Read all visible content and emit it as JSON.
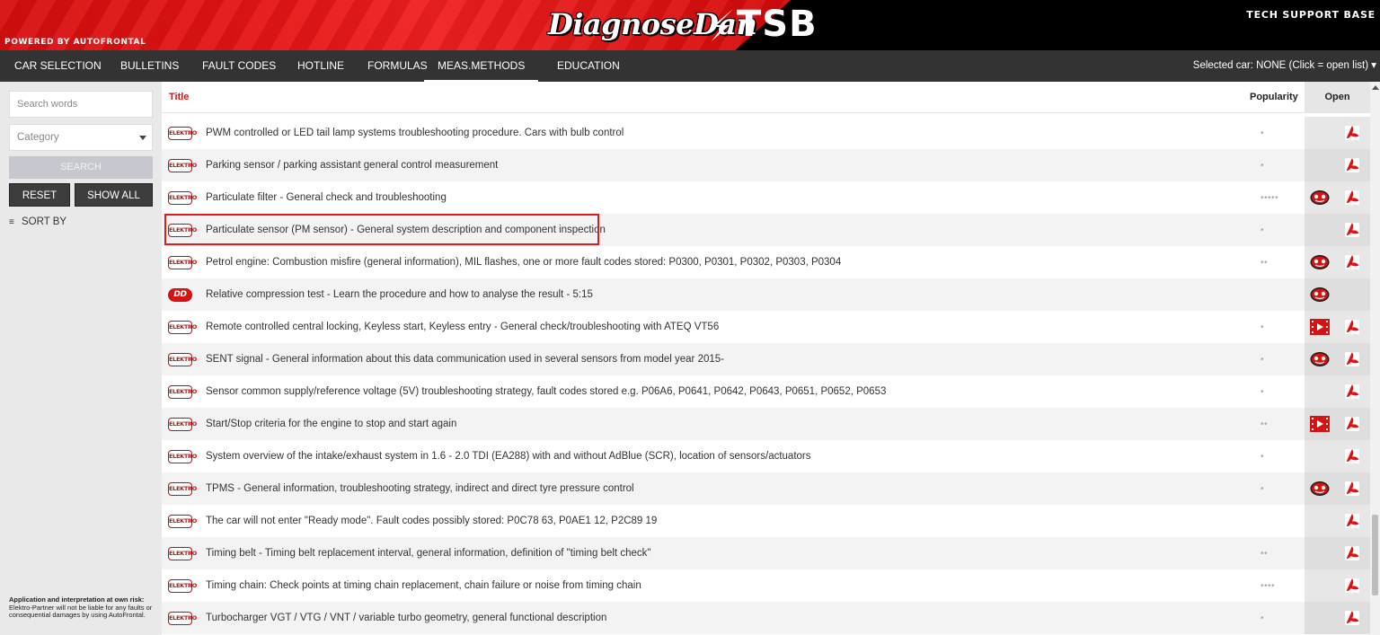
{
  "header": {
    "powered_by": "POWERED BY AUTOFRONTAL",
    "logo_script": "DiagnoseDan",
    "logo_tsb": "TSB",
    "caption": "TECH SUPPORT BASE"
  },
  "nav": {
    "items": [
      "CAR SELECTION",
      "BULLETINS",
      "FAULT CODES",
      "HOTLINE",
      "FORMULAS",
      "MEAS.METHODS",
      "EDUCATION"
    ],
    "active": "MEAS.METHODS",
    "selected_car": "Selected car: NONE (Click = open list) ▾"
  },
  "sidebar": {
    "search_placeholder": "Search words",
    "category_placeholder": "Category",
    "search_label": "SEARCH",
    "reset_label": "RESET",
    "show_all_label": "SHOW ALL",
    "sort_by_label": "SORT BY",
    "disclaimer_title": "Application and interpretation at own risk:",
    "disclaimer_body": "Elektro-Partner will not be liable for any faults or consequential damages by using AutoFrontal."
  },
  "table": {
    "col_title": "Title",
    "col_popularity": "Popularity",
    "col_open": "Open",
    "badge_elektro": "ELEKTRO",
    "badge_dd": "DD",
    "rows": [
      {
        "title": "PWM controlled or LED tail lamp systems troubleshooting procedure. Cars with bulb control",
        "badge": "elektro",
        "pop": "•",
        "video": "",
        "pdf": true
      },
      {
        "title": "Parking sensor / parking assistant general control measurement",
        "badge": "elektro",
        "pop": "•",
        "video": "",
        "pdf": true
      },
      {
        "title": "Particulate filter - General check and troubleshooting",
        "badge": "elektro",
        "pop": "•••••",
        "video": "dd",
        "pdf": true
      },
      {
        "title": "Particulate sensor (PM sensor) - General system description and component inspection",
        "badge": "elektro",
        "pop": "•",
        "video": "",
        "pdf": true
      },
      {
        "title": "Petrol engine: Combustion misfire (general information), MIL flashes, one or more fault codes stored: P0300, P0301, P0302, P0303, P0304",
        "badge": "elektro",
        "pop": "••",
        "video": "dd",
        "pdf": true
      },
      {
        "title": "Relative compression test - Learn the procedure and how to analyse the result - 5:15",
        "badge": "dd",
        "pop": "",
        "video": "dd",
        "pdf": false
      },
      {
        "title": "Remote controlled central locking, Keyless start, Keyless entry - General check/troubleshooting with ATEQ VT56",
        "badge": "elektro",
        "pop": "•",
        "video": "film",
        "pdf": true
      },
      {
        "title": "SENT signal - General information about this data communication used in several sensors from model year 2015-",
        "badge": "elektro",
        "pop": "•",
        "video": "dd",
        "pdf": true
      },
      {
        "title": "Sensor common supply/reference voltage (5V) troubleshooting strategy, fault codes stored e.g. P06A6, P0641, P0642, P0643, P0651, P0652, P0653",
        "badge": "elektro",
        "pop": "•",
        "video": "",
        "pdf": true
      },
      {
        "title": "Start/Stop criteria for the engine to stop and start again",
        "badge": "elektro",
        "pop": "••",
        "video": "film",
        "pdf": true
      },
      {
        "title": "System overview of the intake/exhaust system in 1.6 - 2.0 TDI (EA288) with and without AdBlue (SCR), location of sensors/actuators",
        "badge": "elektro",
        "pop": "•",
        "video": "",
        "pdf": true
      },
      {
        "title": "TPMS - General information, troubleshooting strategy, indirect and direct tyre pressure control",
        "badge": "elektro",
        "pop": "•",
        "video": "dd",
        "pdf": true
      },
      {
        "title": "The car will not enter \"Ready mode\". Fault codes possibly stored: P0C78 63, P0AE1 12, P2C89 19",
        "badge": "elektro",
        "pop": "",
        "video": "",
        "pdf": true
      },
      {
        "title": "Timing belt - Timing belt replacement interval, general information, definition of \"timing belt check\"",
        "badge": "elektro",
        "pop": "••",
        "video": "",
        "pdf": true
      },
      {
        "title": "Timing chain: Check points at timing chain replacement, chain failure or noise from timing chain",
        "badge": "elektro",
        "pop": "••••",
        "video": "",
        "pdf": true
      },
      {
        "title": "Turbocharger VGT / VTG / VNT / variable turbo geometry, general functional description",
        "badge": "elektro",
        "pop": "•",
        "video": "",
        "pdf": true
      }
    ]
  },
  "colors": {
    "brand_red": "#d71212",
    "nav_bg": "#333333",
    "sidebar_bg": "#e9e9e9"
  }
}
